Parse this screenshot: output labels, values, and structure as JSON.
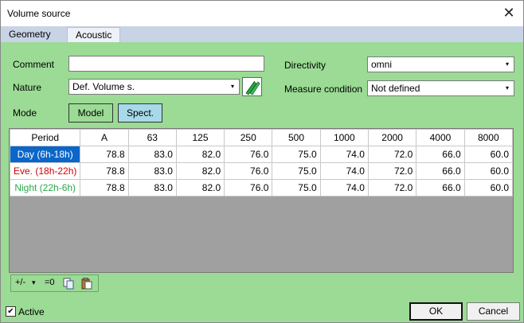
{
  "window": {
    "title": "Volume source",
    "close_glyph": "✕"
  },
  "tabs": [
    {
      "label": "Geometry",
      "active": false
    },
    {
      "label": "Acoustic",
      "active": true
    }
  ],
  "form": {
    "comment": {
      "label": "Comment",
      "value": ""
    },
    "nature": {
      "label": "Nature",
      "value": "Def. Volume s."
    },
    "directivity": {
      "label": "Directivity",
      "value": "omni"
    },
    "measure_condition": {
      "label": "Measure condition",
      "value": "Not defined"
    },
    "mode": {
      "label": "Mode",
      "model_label": "Model",
      "spect_label": "Spect.",
      "selected": "Spect."
    }
  },
  "table": {
    "headers": [
      "Period",
      "A",
      "63",
      "125",
      "250",
      "500",
      "1000",
      "2000",
      "4000",
      "8000"
    ],
    "rows": [
      {
        "period": "Day (6h-18h)",
        "values": [
          "78.8",
          "83.0",
          "82.0",
          "76.0",
          "75.0",
          "74.0",
          "72.0",
          "66.0",
          "60.0"
        ]
      },
      {
        "period": "Eve. (18h-22h)",
        "values": [
          "78.8",
          "83.0",
          "82.0",
          "76.0",
          "75.0",
          "74.0",
          "72.0",
          "66.0",
          "60.0"
        ]
      },
      {
        "period": "Night (22h-6h)",
        "values": [
          "78.8",
          "83.0",
          "82.0",
          "76.0",
          "75.0",
          "74.0",
          "72.0",
          "66.0",
          "60.0"
        ]
      }
    ]
  },
  "toolbar": {
    "plusminus": "+/-",
    "dropdown_glyph": "▾",
    "zero": "=0"
  },
  "footer": {
    "active_label": "Active",
    "active_checked": true,
    "check_glyph": "✔",
    "ok_label": "OK",
    "cancel_label": "Cancel"
  },
  "colors": {
    "background": "#9bdb95",
    "day": "#0a66c8",
    "evening": "#d40000",
    "night": "#2aa84a",
    "spect_selected": "#a7d9e8"
  },
  "icons": [
    "close-icon",
    "dropdown-arrow-icon",
    "nature-edit-icon",
    "copy-icon",
    "paste-icon",
    "checkbox-check-icon"
  ]
}
